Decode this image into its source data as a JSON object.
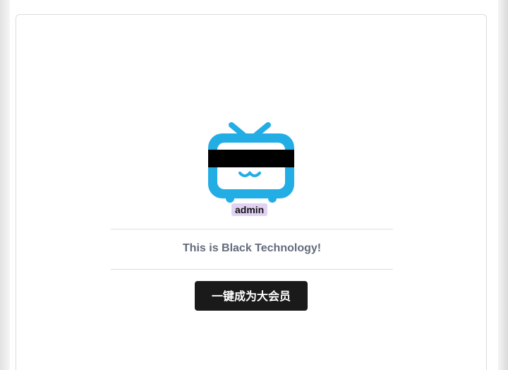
{
  "profile": {
    "username": "admin",
    "avatar_icon": "bilibili-tv-icon",
    "avatar_color": "#23ade5",
    "redaction_color": "#000000",
    "name_tag_color": "#e1d2f4"
  },
  "tagline": "This is Black Technology!",
  "actions": {
    "vip_button_label": "一键成为大会员",
    "vip_button_color": "#1a1a1a"
  }
}
